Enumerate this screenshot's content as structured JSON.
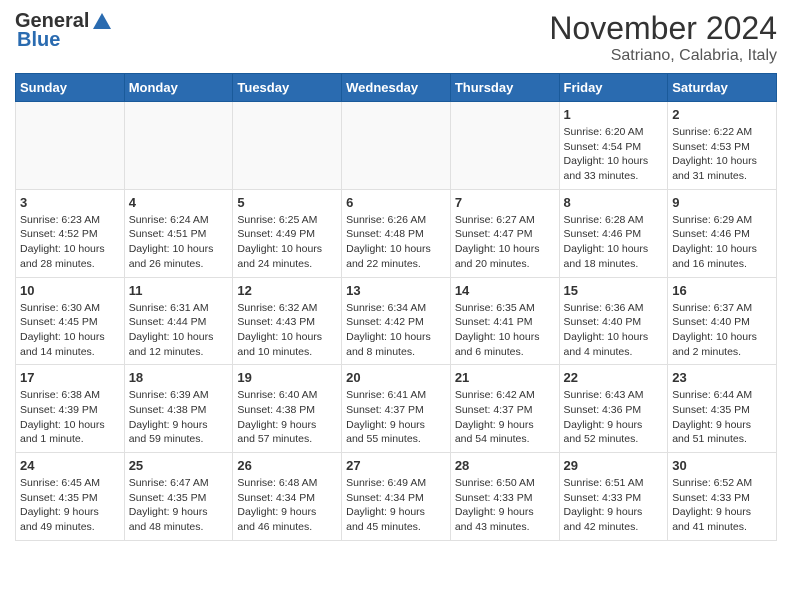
{
  "logo": {
    "general": "General",
    "blue": "Blue"
  },
  "header": {
    "month": "November 2024",
    "location": "Satriano, Calabria, Italy"
  },
  "weekdays": [
    "Sunday",
    "Monday",
    "Tuesday",
    "Wednesday",
    "Thursday",
    "Friday",
    "Saturday"
  ],
  "weeks": [
    [
      {
        "day": "",
        "info": ""
      },
      {
        "day": "",
        "info": ""
      },
      {
        "day": "",
        "info": ""
      },
      {
        "day": "",
        "info": ""
      },
      {
        "day": "",
        "info": ""
      },
      {
        "day": "1",
        "info": "Sunrise: 6:20 AM\nSunset: 4:54 PM\nDaylight: 10 hours\nand 33 minutes."
      },
      {
        "day": "2",
        "info": "Sunrise: 6:22 AM\nSunset: 4:53 PM\nDaylight: 10 hours\nand 31 minutes."
      }
    ],
    [
      {
        "day": "3",
        "info": "Sunrise: 6:23 AM\nSunset: 4:52 PM\nDaylight: 10 hours\nand 28 minutes."
      },
      {
        "day": "4",
        "info": "Sunrise: 6:24 AM\nSunset: 4:51 PM\nDaylight: 10 hours\nand 26 minutes."
      },
      {
        "day": "5",
        "info": "Sunrise: 6:25 AM\nSunset: 4:49 PM\nDaylight: 10 hours\nand 24 minutes."
      },
      {
        "day": "6",
        "info": "Sunrise: 6:26 AM\nSunset: 4:48 PM\nDaylight: 10 hours\nand 22 minutes."
      },
      {
        "day": "7",
        "info": "Sunrise: 6:27 AM\nSunset: 4:47 PM\nDaylight: 10 hours\nand 20 minutes."
      },
      {
        "day": "8",
        "info": "Sunrise: 6:28 AM\nSunset: 4:46 PM\nDaylight: 10 hours\nand 18 minutes."
      },
      {
        "day": "9",
        "info": "Sunrise: 6:29 AM\nSunset: 4:46 PM\nDaylight: 10 hours\nand 16 minutes."
      }
    ],
    [
      {
        "day": "10",
        "info": "Sunrise: 6:30 AM\nSunset: 4:45 PM\nDaylight: 10 hours\nand 14 minutes."
      },
      {
        "day": "11",
        "info": "Sunrise: 6:31 AM\nSunset: 4:44 PM\nDaylight: 10 hours\nand 12 minutes."
      },
      {
        "day": "12",
        "info": "Sunrise: 6:32 AM\nSunset: 4:43 PM\nDaylight: 10 hours\nand 10 minutes."
      },
      {
        "day": "13",
        "info": "Sunrise: 6:34 AM\nSunset: 4:42 PM\nDaylight: 10 hours\nand 8 minutes."
      },
      {
        "day": "14",
        "info": "Sunrise: 6:35 AM\nSunset: 4:41 PM\nDaylight: 10 hours\nand 6 minutes."
      },
      {
        "day": "15",
        "info": "Sunrise: 6:36 AM\nSunset: 4:40 PM\nDaylight: 10 hours\nand 4 minutes."
      },
      {
        "day": "16",
        "info": "Sunrise: 6:37 AM\nSunset: 4:40 PM\nDaylight: 10 hours\nand 2 minutes."
      }
    ],
    [
      {
        "day": "17",
        "info": "Sunrise: 6:38 AM\nSunset: 4:39 PM\nDaylight: 10 hours\nand 1 minute."
      },
      {
        "day": "18",
        "info": "Sunrise: 6:39 AM\nSunset: 4:38 PM\nDaylight: 9 hours\nand 59 minutes."
      },
      {
        "day": "19",
        "info": "Sunrise: 6:40 AM\nSunset: 4:38 PM\nDaylight: 9 hours\nand 57 minutes."
      },
      {
        "day": "20",
        "info": "Sunrise: 6:41 AM\nSunset: 4:37 PM\nDaylight: 9 hours\nand 55 minutes."
      },
      {
        "day": "21",
        "info": "Sunrise: 6:42 AM\nSunset: 4:37 PM\nDaylight: 9 hours\nand 54 minutes."
      },
      {
        "day": "22",
        "info": "Sunrise: 6:43 AM\nSunset: 4:36 PM\nDaylight: 9 hours\nand 52 minutes."
      },
      {
        "day": "23",
        "info": "Sunrise: 6:44 AM\nSunset: 4:35 PM\nDaylight: 9 hours\nand 51 minutes."
      }
    ],
    [
      {
        "day": "24",
        "info": "Sunrise: 6:45 AM\nSunset: 4:35 PM\nDaylight: 9 hours\nand 49 minutes."
      },
      {
        "day": "25",
        "info": "Sunrise: 6:47 AM\nSunset: 4:35 PM\nDaylight: 9 hours\nand 48 minutes."
      },
      {
        "day": "26",
        "info": "Sunrise: 6:48 AM\nSunset: 4:34 PM\nDaylight: 9 hours\nand 46 minutes."
      },
      {
        "day": "27",
        "info": "Sunrise: 6:49 AM\nSunset: 4:34 PM\nDaylight: 9 hours\nand 45 minutes."
      },
      {
        "day": "28",
        "info": "Sunrise: 6:50 AM\nSunset: 4:33 PM\nDaylight: 9 hours\nand 43 minutes."
      },
      {
        "day": "29",
        "info": "Sunrise: 6:51 AM\nSunset: 4:33 PM\nDaylight: 9 hours\nand 42 minutes."
      },
      {
        "day": "30",
        "info": "Sunrise: 6:52 AM\nSunset: 4:33 PM\nDaylight: 9 hours\nand 41 minutes."
      }
    ]
  ]
}
